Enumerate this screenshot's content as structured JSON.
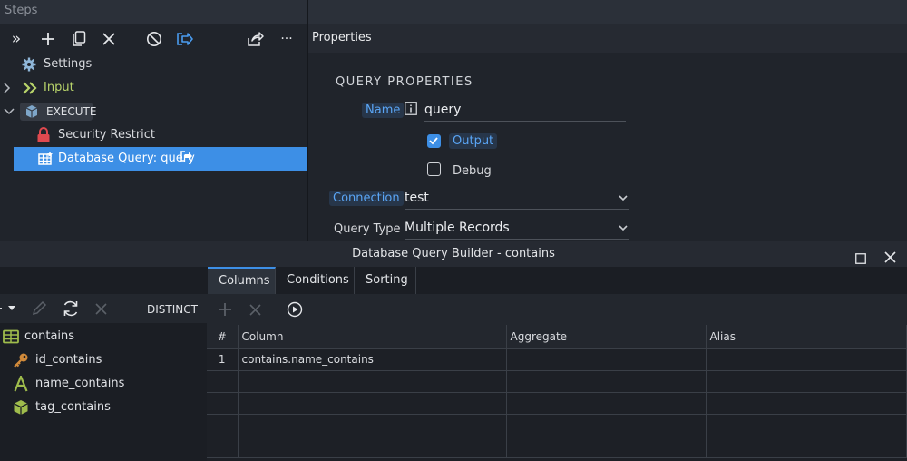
{
  "steps": {
    "header": "Steps",
    "tree": [
      {
        "label": "Settings"
      },
      {
        "label": "Input"
      },
      {
        "label": "EXECUTE"
      },
      {
        "label": "Security Restrict"
      },
      {
        "label": "Database Query: query"
      }
    ]
  },
  "properties": {
    "title": "Properties",
    "section": "QUERY PROPERTIES",
    "name_label": "Name",
    "name_value": "query",
    "output_label": "Output",
    "output_checked": true,
    "debug_label": "Debug",
    "debug_checked": false,
    "connection_label": "Connection",
    "connection_value": "test",
    "query_type_label": "Query Type",
    "query_type_value": "Multiple Records"
  },
  "query_builder": {
    "title": "Database Query Builder - contains",
    "tabs": [
      {
        "label": "Columns",
        "active": true
      },
      {
        "label": "Conditions",
        "active": false
      },
      {
        "label": "Sorting",
        "active": false
      }
    ],
    "distinct_label": "DISTINCT",
    "table_name": "contains",
    "fields": [
      {
        "name": "id_contains",
        "icon": "key-icon"
      },
      {
        "name": "name_contains",
        "icon": "text-field-icon"
      },
      {
        "name": "tag_contains",
        "icon": "cube-icon"
      }
    ],
    "columns_header": [
      "#",
      "Column",
      "Aggregate",
      "Alias"
    ],
    "rows": [
      {
        "n": "1",
        "column": "contains.name_contains",
        "aggregate": "",
        "alias": ""
      }
    ]
  },
  "colors": {
    "accent": "#3d8fe6",
    "input_green": "#b7d36a",
    "lock_red": "#e0494f",
    "key_orange": "#d18a3a",
    "field_green": "#9fbc4c"
  }
}
